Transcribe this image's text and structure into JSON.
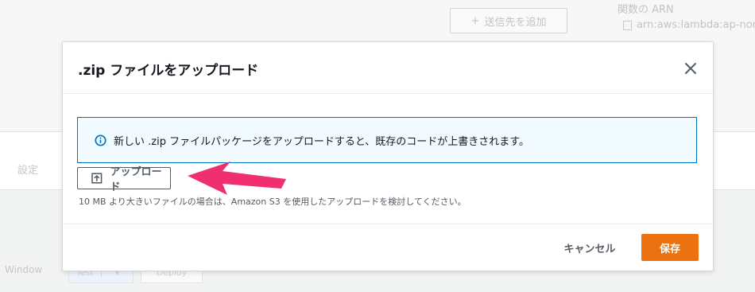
{
  "background": {
    "add_destination_label": "送信先を追加",
    "function_arn_label": "関数の ARN",
    "function_arn_value": "arn:aws:lambda:ap-nor",
    "settings_label": "設定",
    "window_label": "Window",
    "test_label": "Test",
    "deploy_label": "Deploy"
  },
  "modal": {
    "title": ".zip ファイルをアップロード",
    "info_message": "新しい .zip ファイルパッケージをアップロードすると、既存のコードが上書きされます。",
    "upload_button_label": "アップロード",
    "upload_hint": "10 MB より大きいファイルの場合は、Amazon S3 を使用したアップロードを検討してください。",
    "cancel_label": "キャンセル",
    "save_label": "保存"
  },
  "colors": {
    "accent": "#ec7211",
    "info_border": "#0073bb",
    "info_bg": "#f1faff",
    "annotation_arrow": "#f0306e"
  },
  "icons": {
    "info": "info-circle-icon",
    "upload": "upload-icon",
    "close": "close-icon",
    "add": "plus-icon",
    "copy": "copy-icon"
  }
}
